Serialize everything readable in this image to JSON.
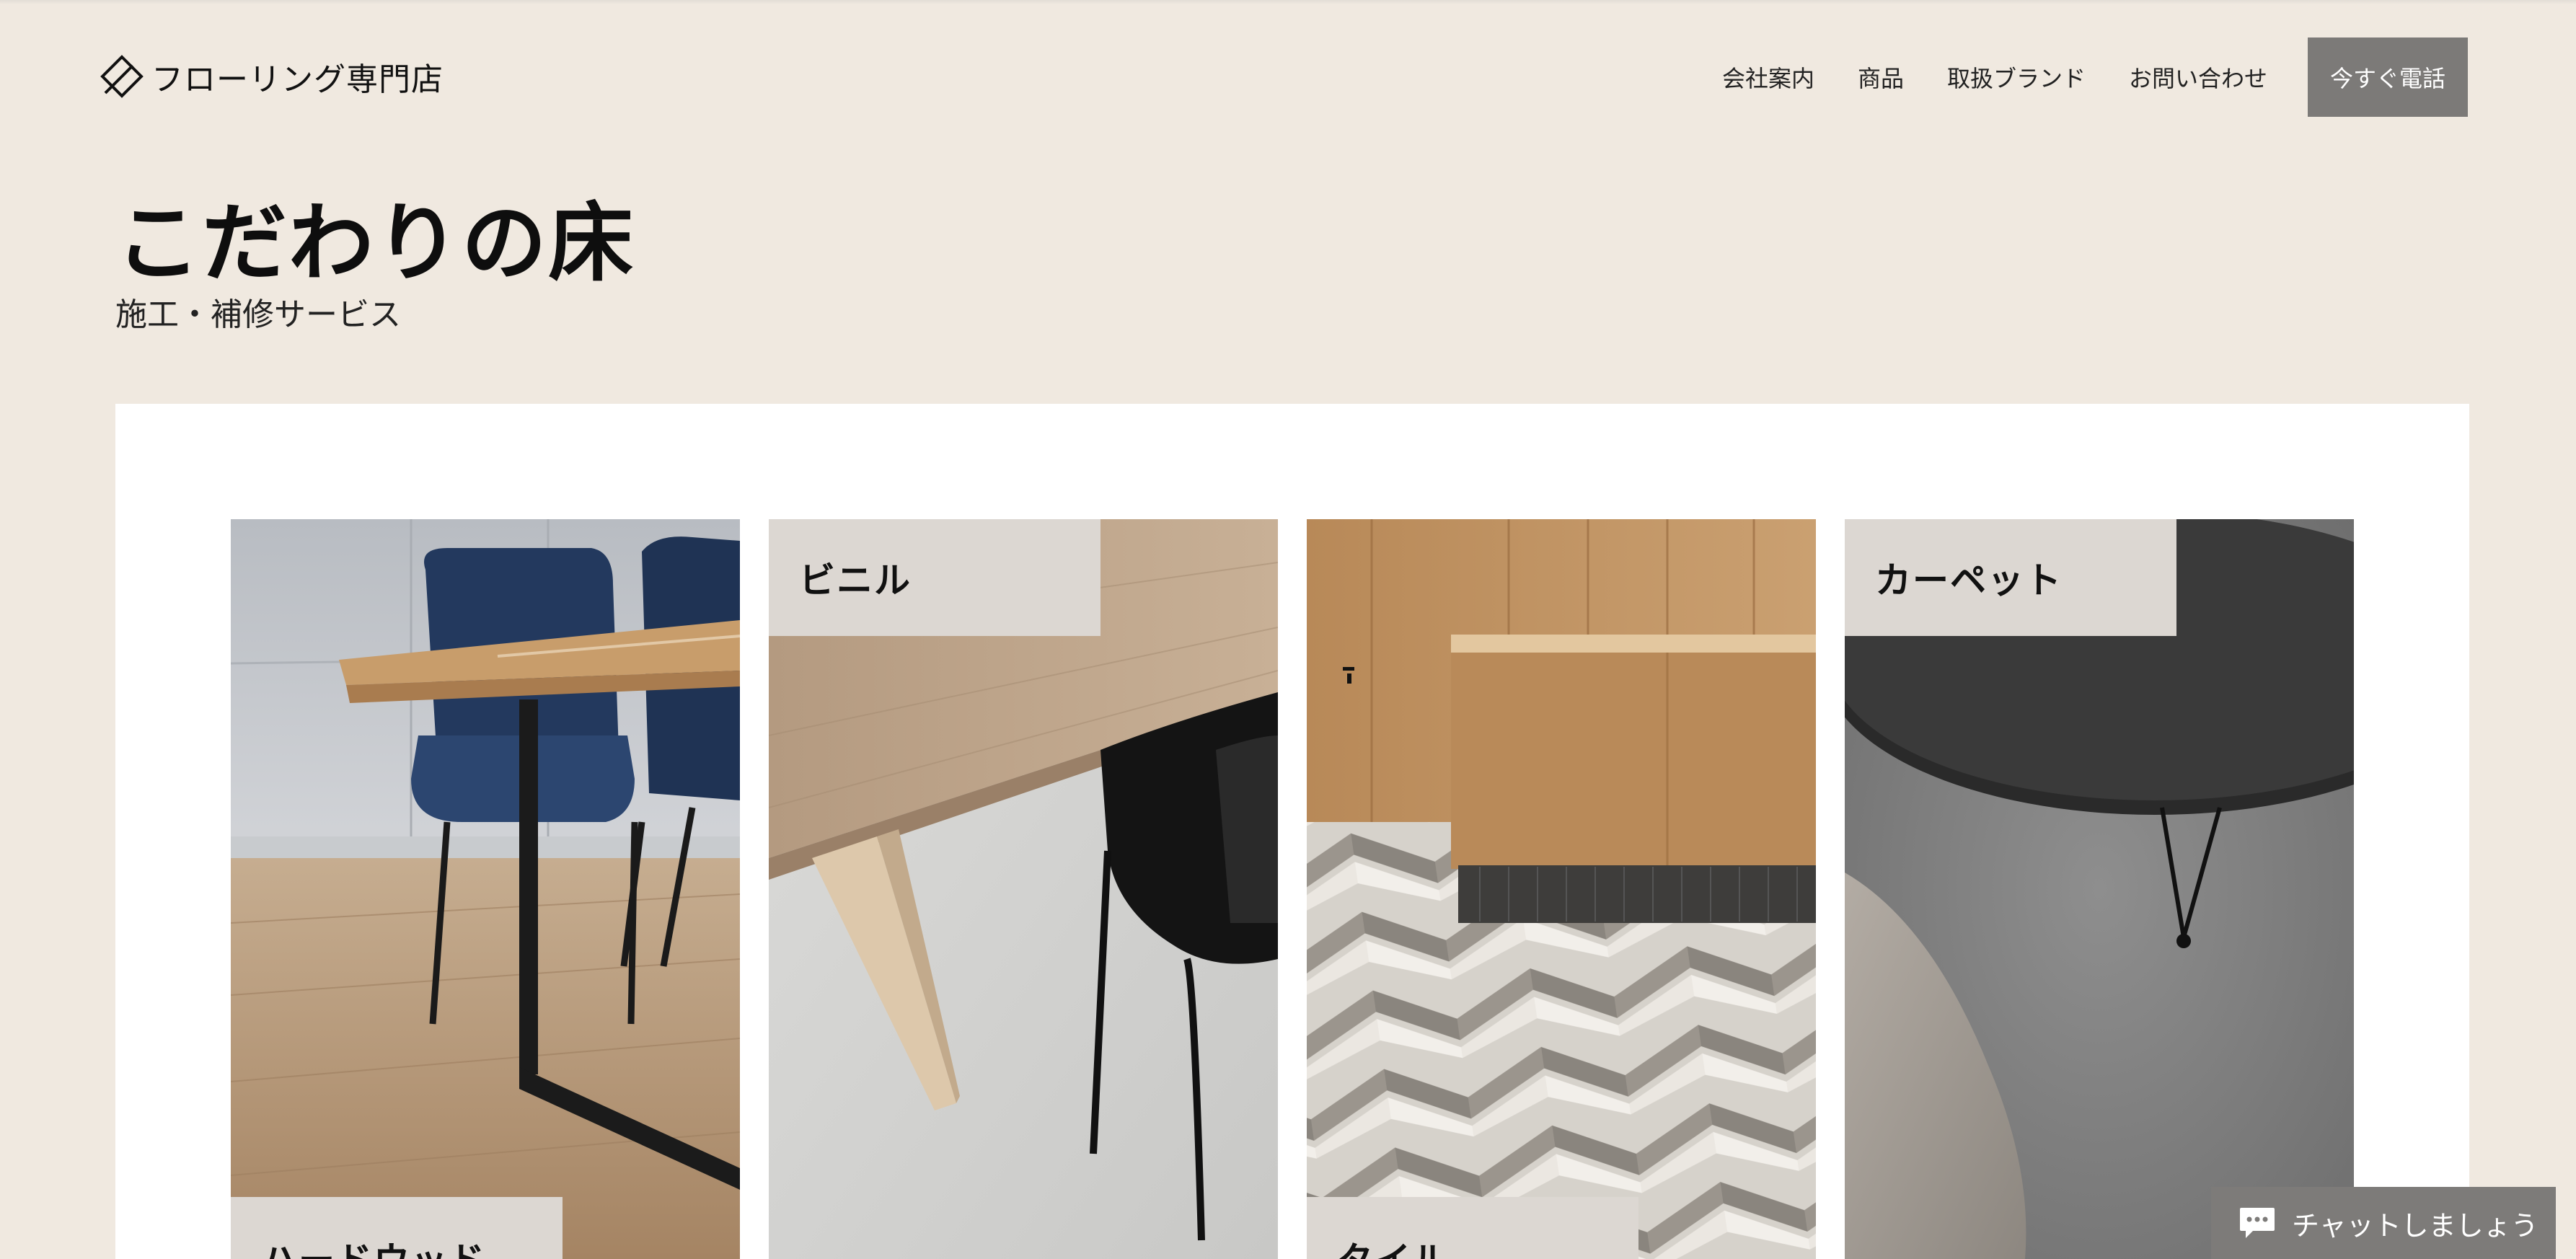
{
  "header": {
    "logo_text": "フローリング専門店",
    "nav": [
      "会社案内",
      "商品",
      "取扱ブランド",
      "お問い合わせ"
    ],
    "call_button": "今すぐ電話"
  },
  "hero": {
    "title": "こだわりの床",
    "subtitle": "施工・補修サービス"
  },
  "categories": [
    {
      "label": "ハードウッド",
      "photo": "dining-table-wood-floor"
    },
    {
      "label": "ビニル",
      "photo": "wood-table-concrete-floor"
    },
    {
      "label": "タイル",
      "photo": "herringbone-tile-floor"
    },
    {
      "label": "カーペット",
      "photo": "black-table-grey-rug"
    }
  ],
  "chat": {
    "label": "チャットしましょう"
  },
  "colors": {
    "background": "#f0e9e0",
    "panel": "#ffffff",
    "label_bg": "#dcd7d2",
    "button": "#7c7a78"
  }
}
